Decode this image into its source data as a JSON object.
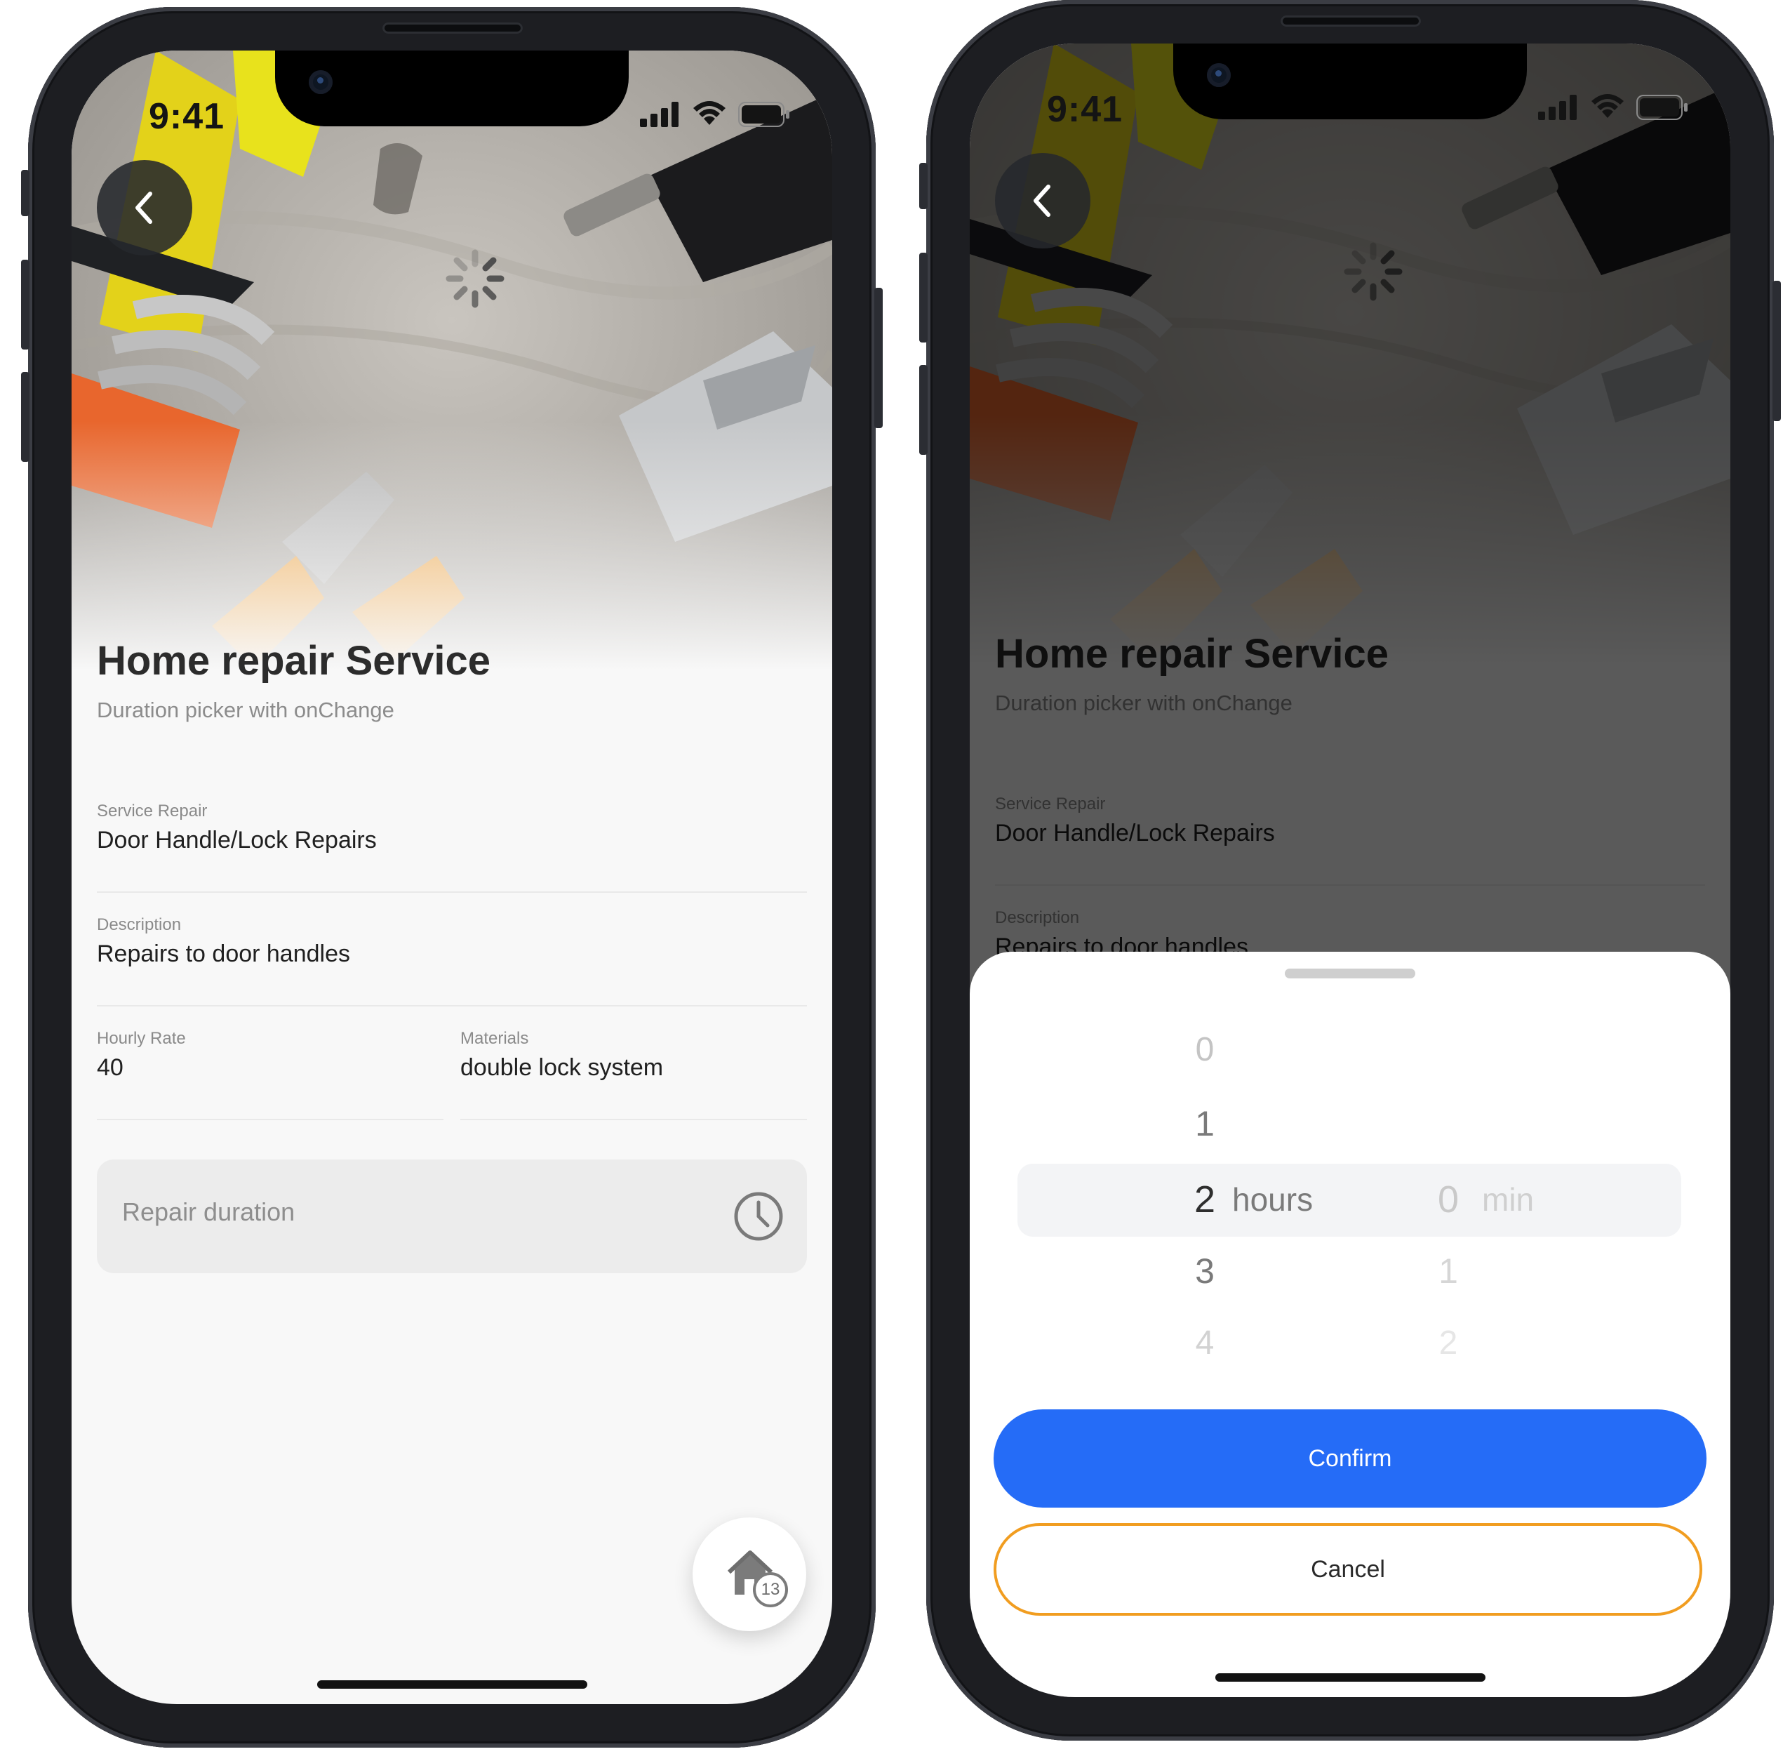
{
  "status_bar": {
    "time": "9:41"
  },
  "detail": {
    "title": "Home repair Service",
    "subtitle": "Duration picker with onChange",
    "fields": {
      "service_repair": {
        "label": "Service Repair",
        "value": "Door Handle/Lock Repairs"
      },
      "description": {
        "label": "Description",
        "value": "Repairs to door handles"
      },
      "hourly_rate": {
        "label": "Hourly Rate",
        "value": "40"
      },
      "materials": {
        "label": "Materials",
        "value": "double lock system"
      }
    },
    "duration_input": {
      "placeholder": "Repair duration",
      "icon": "clock-icon"
    },
    "fab": {
      "icon": "home-icon",
      "badge": "13"
    }
  },
  "picker": {
    "hours": [
      "0",
      "1",
      "2",
      "3",
      "4"
    ],
    "minutes": [
      "0",
      "1",
      "2"
    ],
    "selected_hours": "2",
    "selected_minutes": "0",
    "hours_unit": "hours",
    "minutes_unit": "min",
    "confirm_label": "Confirm",
    "cancel_label": "Cancel"
  },
  "colors": {
    "primary": "#256cf7",
    "cancel_border": "#f19d20",
    "background": "#f8f8f8",
    "input_background": "#ececec"
  }
}
